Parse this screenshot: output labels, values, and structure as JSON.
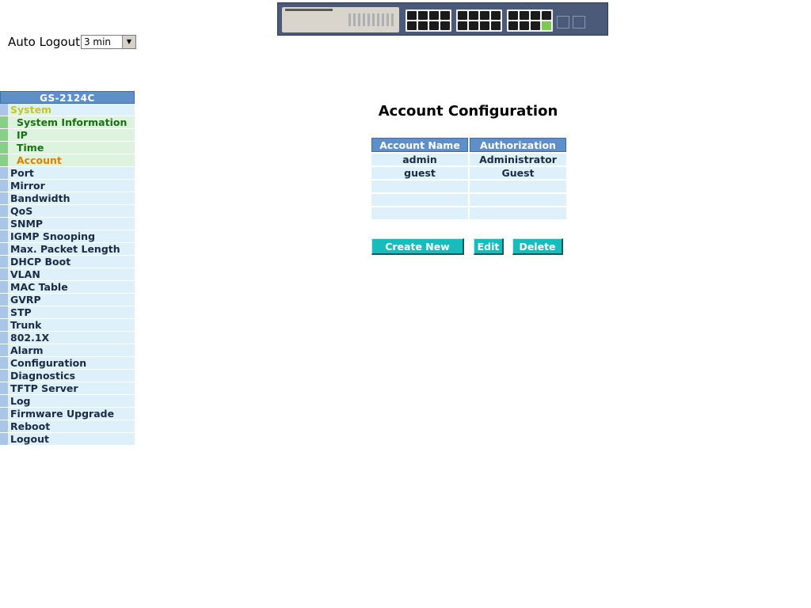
{
  "header": {
    "auto_logout_label": "Auto Logout",
    "auto_logout_value": "3 min"
  },
  "nav": {
    "title": "GS-2124C",
    "items": [
      {
        "label": "System",
        "type": "section"
      },
      {
        "label": "System Information",
        "type": "sub"
      },
      {
        "label": "IP",
        "type": "sub"
      },
      {
        "label": "Time",
        "type": "sub"
      },
      {
        "label": "Account",
        "type": "sub",
        "active": true
      },
      {
        "label": "Port"
      },
      {
        "label": "Mirror"
      },
      {
        "label": "Bandwidth"
      },
      {
        "label": "QoS"
      },
      {
        "label": "SNMP"
      },
      {
        "label": "IGMP Snooping"
      },
      {
        "label": "Max. Packet Length"
      },
      {
        "label": "DHCP Boot"
      },
      {
        "label": "VLAN"
      },
      {
        "label": "MAC Table"
      },
      {
        "label": "GVRP"
      },
      {
        "label": "STP"
      },
      {
        "label": "Trunk"
      },
      {
        "label": "802.1X"
      },
      {
        "label": "Alarm"
      },
      {
        "label": "Configuration"
      },
      {
        "label": "Diagnostics"
      },
      {
        "label": "TFTP Server"
      },
      {
        "label": "Log"
      },
      {
        "label": "Firmware Upgrade"
      },
      {
        "label": "Reboot"
      },
      {
        "label": "Logout"
      }
    ]
  },
  "main": {
    "title": "Account Configuration",
    "table": {
      "headers": [
        "Account Name",
        "Authorization"
      ],
      "rows": [
        [
          "admin",
          "Administrator"
        ],
        [
          "guest",
          "Guest"
        ],
        [
          "",
          ""
        ],
        [
          "",
          ""
        ],
        [
          "",
          ""
        ]
      ]
    },
    "buttons": {
      "create": "Create New",
      "edit": "Edit",
      "delete": "Delete"
    }
  },
  "colors": {
    "nav_header": "#5f8fc9",
    "nav_item_bg": "#def1fb",
    "nav_sub_bg": "#ddf3dd",
    "active_item": "#e08000",
    "button": "#18bcbc"
  }
}
